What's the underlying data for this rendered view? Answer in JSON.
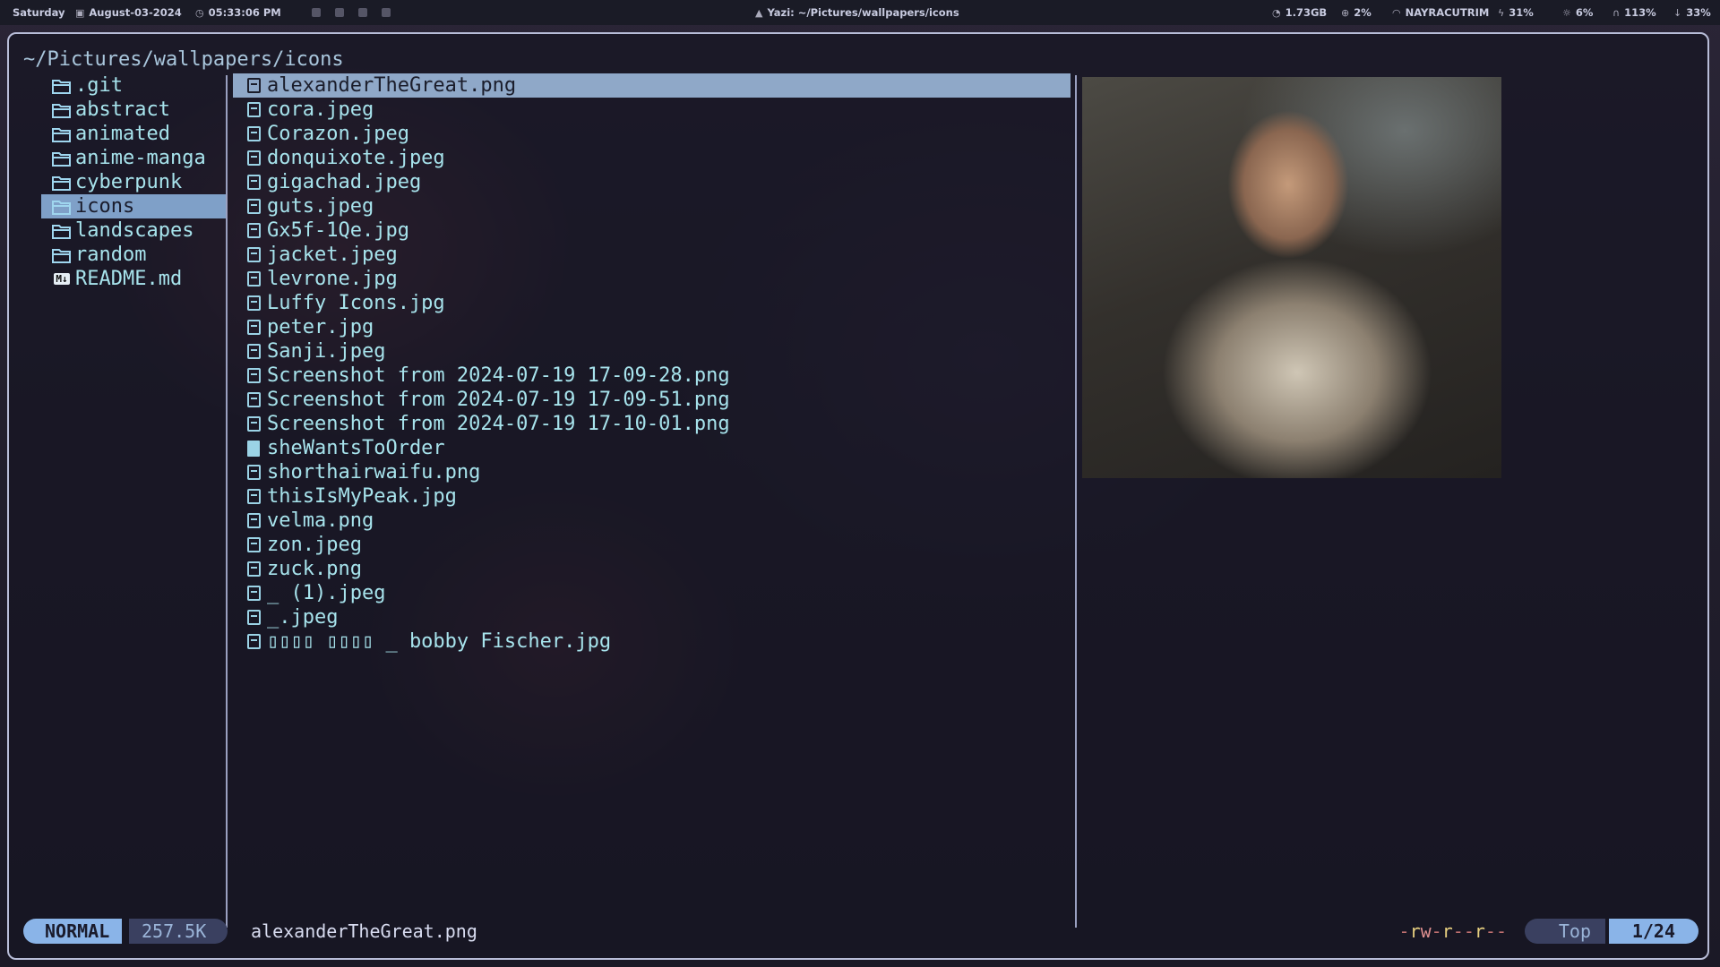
{
  "topbar": {
    "day": "Saturday",
    "date": "August-03-2024",
    "time": "05:33:06 PM",
    "title": "Yazi: ~/Pictures/wallpapers/icons",
    "memory": "1.73GB",
    "cpu": "2%",
    "wifi": "NAYRACUTRIM",
    "battery": "31%",
    "brightness": "6%",
    "volume": "113%",
    "mic": "33%"
  },
  "path": "~/Pictures/wallpapers/icons",
  "parent_entries": [
    {
      "name": ".git",
      "type": "folder"
    },
    {
      "name": "abstract",
      "type": "folder"
    },
    {
      "name": "animated",
      "type": "folder"
    },
    {
      "name": "anime-manga",
      "type": "folder"
    },
    {
      "name": "cyberpunk",
      "type": "folder"
    },
    {
      "name": "icons",
      "type": "folder",
      "selected": true
    },
    {
      "name": "landscapes",
      "type": "folder"
    },
    {
      "name": "random",
      "type": "folder"
    },
    {
      "name": "README.md",
      "type": "markdown"
    }
  ],
  "files": [
    {
      "name": "alexanderTheGreat.png",
      "type": "image",
      "selected": true
    },
    {
      "name": "cora.jpeg",
      "type": "image"
    },
    {
      "name": "Corazon.jpeg",
      "type": "image"
    },
    {
      "name": "donquixote.jpeg",
      "type": "image"
    },
    {
      "name": "gigachad.jpeg",
      "type": "image"
    },
    {
      "name": "guts.jpeg",
      "type": "image"
    },
    {
      "name": "Gx5f-1Qe.jpg",
      "type": "image"
    },
    {
      "name": "jacket.jpeg",
      "type": "image"
    },
    {
      "name": "levrone.jpg",
      "type": "image"
    },
    {
      "name": "Luffy Icons.jpg",
      "type": "image"
    },
    {
      "name": "peter.jpg",
      "type": "image"
    },
    {
      "name": "Sanji.jpeg",
      "type": "image"
    },
    {
      "name": "Screenshot from 2024-07-19 17-09-28.png",
      "type": "image"
    },
    {
      "name": "Screenshot from 2024-07-19 17-09-51.png",
      "type": "image"
    },
    {
      "name": "Screenshot from 2024-07-19 17-10-01.png",
      "type": "image"
    },
    {
      "name": "sheWantsToOrder",
      "type": "document"
    },
    {
      "name": "shorthairwaifu.png",
      "type": "image"
    },
    {
      "name": "thisIsMyPeak.jpg",
      "type": "image"
    },
    {
      "name": "velma.png",
      "type": "image"
    },
    {
      "name": "zon.jpeg",
      "type": "image"
    },
    {
      "name": "zuck.png",
      "type": "image"
    },
    {
      "name": "_ (1).jpeg",
      "type": "image"
    },
    {
      "name": "_.jpeg",
      "type": "image"
    },
    {
      "name": "▯▯▯▯ ▯▯▯▯ _ bobby Fischer.jpg",
      "type": "image"
    }
  ],
  "status": {
    "mode": "NORMAL",
    "size": "257.5K",
    "filename": "alexanderTheGreat.png",
    "permissions": "-rw-r--r--",
    "position": "Top",
    "count": "1/24"
  },
  "colors": {
    "selection": "#8fa8c8",
    "accent": "#8ab4e8",
    "text": "#a7e3ec"
  }
}
